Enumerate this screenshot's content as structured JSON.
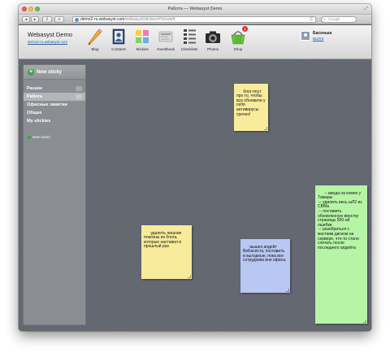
{
  "window": {
    "title": "Работа — Webasyst Demo"
  },
  "toolbar": {
    "back": "◂",
    "forward": "▸",
    "share": "⇪",
    "url_host": "demo2-ru.webasyst.com",
    "url_path": "/webasyst/stickies/#/sheet/4",
    "reload": "C",
    "search_placeholder": "Google"
  },
  "brand": {
    "title": "Webasyst Demo",
    "subtitle": "demo2-ru.webasyst.com"
  },
  "apps": [
    {
      "label": "Blog",
      "icon": "pencil-icon"
    },
    {
      "label": "Contacts",
      "icon": "contact-card-icon"
    },
    {
      "label": "Stickies",
      "icon": "stickies-icon"
    },
    {
      "label": "Guestbook",
      "icon": "guestbook-icon"
    },
    {
      "label": "Checklists",
      "icon": "checklist-icon"
    },
    {
      "label": "Photos",
      "icon": "camera-icon"
    },
    {
      "label": "Shop",
      "icon": "basket-icon",
      "badge": "1"
    }
  ],
  "user": {
    "name": "Басенька",
    "logout": "Выйти"
  },
  "sidebar": {
    "new_sticky": "New sticky",
    "sheets": [
      {
        "label": "Разное",
        "selected": false
      },
      {
        "label": "Работа",
        "selected": true
      },
      {
        "label": "Офисные заметки",
        "selected": false
      },
      {
        "label": "Общее",
        "selected": false
      },
      {
        "label": "My stickies",
        "selected": false
      }
    ],
    "new_board": "New board"
  },
  "stickies": [
    {
      "text": "блог-пост про то, чтобы все обновили у себя антивирусы срочно!",
      "color": "#f8ec9c"
    },
    {
      "text": "удалить лишние плагины из блога, которые наставил в прошлый раз",
      "color": "#f8ec9c"
    },
    {
      "text": "вышел апдейт ВеБасиста, поставить в выходные, пока все сотрудники вне офиса.",
      "color": "#b9c7f3"
    },
    {
      "text": "-- винда на компе у Тамары\n -- удалить весь шЛ2 из CВМа\n -- поставить обновленную верстку страницы 500-ой ошибки\n -- разобраться с жестким диском на сервере, что-то стало слетать после последнего апдейта",
      "color": "#b6f5a6"
    }
  ]
}
